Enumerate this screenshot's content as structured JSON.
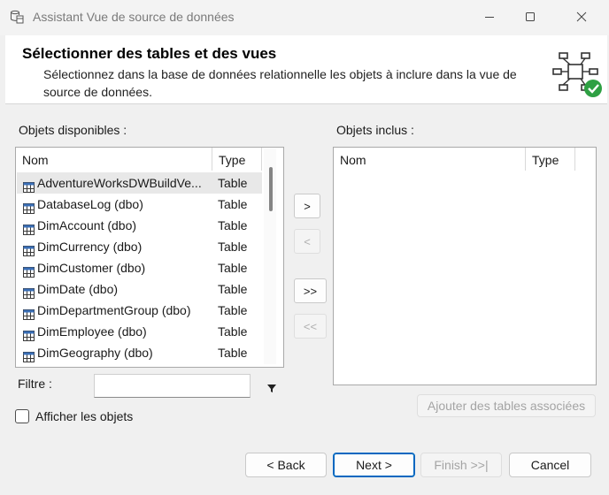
{
  "window": {
    "title": "Assistant Vue de source de données",
    "controls": [
      "minimize-icon",
      "maximize-icon",
      "close-icon"
    ]
  },
  "header": {
    "title": "Sélectionner des tables et des vues",
    "description": "Sélectionnez dans la base de données relationnelle les objets à inclure dans la vue de source de données.",
    "icon": "diagram-check-icon",
    "check_color": "#2ea043"
  },
  "available": {
    "label": "Objets disponibles :",
    "columns": {
      "name": "Nom",
      "type": "Type"
    },
    "rows": [
      {
        "name": "AdventureWorksDWBuildVe...",
        "type": "Table",
        "selected": true
      },
      {
        "name": "DatabaseLog (dbo)",
        "type": "Table"
      },
      {
        "name": "DimAccount (dbo)",
        "type": "Table"
      },
      {
        "name": "DimCurrency (dbo)",
        "type": "Table"
      },
      {
        "name": "DimCustomer (dbo)",
        "type": "Table"
      },
      {
        "name": "DimDate (dbo)",
        "type": "Table"
      },
      {
        "name": "DimDepartmentGroup (dbo)",
        "type": "Table"
      },
      {
        "name": "DimEmployee (dbo)",
        "type": "Table"
      },
      {
        "name": "DimGeography (dbo)",
        "type": "Table"
      }
    ]
  },
  "included": {
    "label": "Objets inclus :",
    "columns": {
      "name": "Nom",
      "type": "Type"
    }
  },
  "transfer": {
    "add": ">",
    "remove": "<",
    "add_all": ">>",
    "remove_all": "<<"
  },
  "filter": {
    "label": "Filtre :",
    "value": "",
    "icon": "filter-icon"
  },
  "show_objects": {
    "label": "Afficher les objets",
    "checked": false
  },
  "related_button": "Ajouter des tables associées",
  "footer": {
    "back": "< Back",
    "next": "Next >",
    "finish": "Finish >>|",
    "cancel": "Cancel"
  }
}
